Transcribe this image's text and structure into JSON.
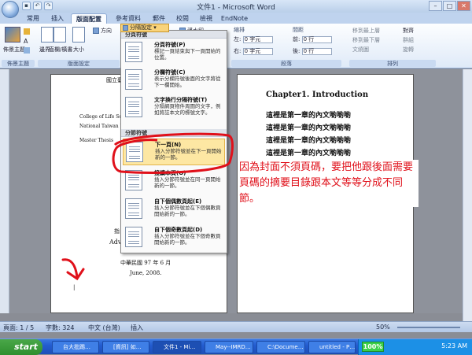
{
  "window": {
    "title": "文件1 - Microsoft Word",
    "controls": [
      "–",
      "□",
      "✕"
    ]
  },
  "tabs": [
    "常用",
    "插入",
    "版面配置",
    "參考資料",
    "郵件",
    "校閱",
    "檢視",
    "EndNote"
  ],
  "active_tab": "版面配置",
  "ribbon": {
    "theme_group": {
      "button": "佈景主題",
      "label": "佈景主題"
    },
    "page_setup": {
      "margins": "邊界",
      "orientation_label": "方向",
      "size": "大小",
      "columns_label": "直欄/橫書",
      "breaks_button": "分隔設定",
      "watermark": "浮水印",
      "label": "版面設定"
    },
    "indent": {
      "title": "縮排",
      "left_label": "左:",
      "left_value": "0 字元",
      "right_label": "右:",
      "right_value": "0 字元"
    },
    "spacing": {
      "title": "間距",
      "before_label": "前:",
      "before_value": "0 行",
      "after_label": "後:",
      "after_value": "0 行",
      "label": "段落"
    },
    "arrange": {
      "items": [
        "移到最上層",
        "移到最下層",
        "文繞圖",
        "對齊",
        "群組",
        "旋轉"
      ],
      "label": "排列"
    }
  },
  "breaks_menu": {
    "section1_header": "分頁符號",
    "items1": [
      {
        "title": "分頁符號(P)",
        "desc": "標記一頁結束與下一頁開始的位置。"
      },
      {
        "title": "分欄符號(C)",
        "desc": "表示分欄符號後面的文字將從下一欄開始。"
      },
      {
        "title": "文字換行分隔符號(T)",
        "desc": "分隔網頁物件周圍的文字，例如將註本文的標號文字。"
      }
    ],
    "section2_header": "分節符號",
    "items2": [
      {
        "title": "下一頁(N)",
        "desc": "插入分節符號並在下一頁開始新的一節。"
      },
      {
        "title": "接續本頁(O)",
        "desc": "插入分節符號並在同一頁開始新的一節。"
      },
      {
        "title": "自下個偶數頁起(E)",
        "desc": "插入分節符號並在下個偶數頁開始新的一節。"
      },
      {
        "title": "自下個奇數頁起(D)",
        "desc": "插入分節符號並在下個奇數頁開始新的一節。"
      }
    ],
    "highlighted": "下一頁(N)"
  },
  "left_page": {
    "top_text": "國立臺灣大",
    "lines": [
      "College of Life Science",
      "National Taiwan Un",
      "Master Thesis"
    ],
    "mid": "指",
    "adv": "Adv",
    "date_cn": "中華民國 97 年 6 月",
    "date_en": "June, 2008."
  },
  "right_page": {
    "heading": "Chapter1. Introduction",
    "body_lines": [
      "這裡是第一章的內文喲喲喲",
      "這裡是第一章的內文喲喲喲",
      "這裡是第一章的內文喲喲喲",
      "這裡是第一章的內文喲喲喲"
    ]
  },
  "annotation": "因為封面不須頁碼，要把他跟後面需要頁碼的摘要目錄跟本文等等分成不同節。",
  "status": {
    "page": "頁面: 1 / 5",
    "words": "字數: 324",
    "lang": "中文 (台灣)",
    "mode": "插入",
    "zoom": "50%"
  },
  "taskbar": {
    "start": "start",
    "tasks": [
      "台大批踢…",
      "[資訊] 如…",
      "文件1 - Mi…",
      "May--IMRD…",
      "C:\\Docume…",
      "untitled - P…"
    ],
    "battery": "100%",
    "clock": "5:23 AM"
  },
  "colors": {
    "annotation": "#e0101a",
    "ribbon_bg": "#dfeaf8",
    "highlight": "#fde7a3",
    "taskbar": "#235ccf"
  }
}
